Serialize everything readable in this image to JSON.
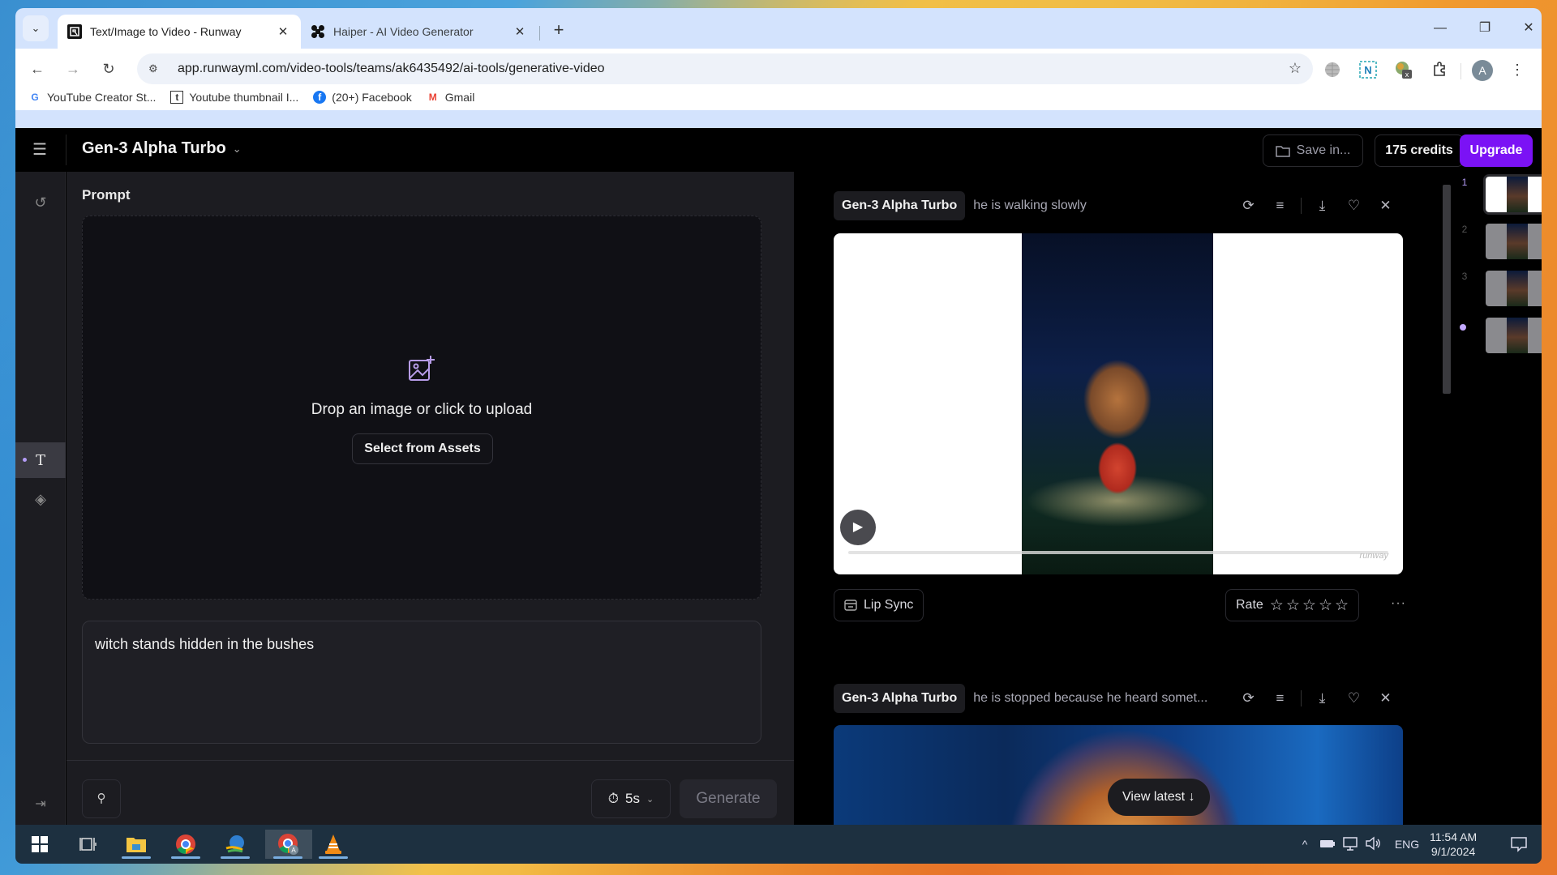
{
  "browser": {
    "tabs": [
      {
        "title": "Text/Image to Video - Runway",
        "favicon": "runway-icon",
        "active": true
      },
      {
        "title": "Haiper - AI Video Generator",
        "favicon": "haiper-icon",
        "active": false
      }
    ],
    "tab_search_icon": "⌄",
    "tab_close_icon": "✕",
    "new_tab_icon": "+",
    "window_controls": {
      "minimize": "—",
      "restore": "❐",
      "close": "✕"
    },
    "nav": {
      "back": "←",
      "forward": "→",
      "reload": "↻"
    },
    "url": "app.runwayml.com/video-tools/teams/ak6435492/ai-tools/generative-video",
    "site_info_icon": "⚙",
    "bookmark_star": "☆",
    "extensions": [
      "globe-icon",
      "n-extension-icon",
      "idm-extension-icon",
      "puzzle-icon"
    ],
    "profile_initial": "A",
    "menu_icon": "⋮",
    "bookmarks": [
      {
        "label": "YouTube Creator St...",
        "icon": "G",
        "color": "#4285f4"
      },
      {
        "label": "Youtube thumbnail I...",
        "icon": "t",
        "color": "#333333"
      },
      {
        "label": "(20+) Facebook",
        "icon": "f",
        "color": "#1877f2"
      },
      {
        "label": "Gmail",
        "icon": "M",
        "color": "#ea4335"
      }
    ]
  },
  "app": {
    "menu_icon": "☰",
    "model_name": "Gen-3 Alpha Turbo",
    "model_chevron": "⌄",
    "save_label": "Save in...",
    "credits_label": "175 credits",
    "upgrade_label": "Upgrade",
    "accent_color": "#7b12f5",
    "rail": {
      "reset_icon": "↺",
      "text_icon": "T",
      "layers_icon": "◈",
      "collapse_icon": "⇥"
    },
    "prompt": {
      "label": "Prompt",
      "dropzone_text": "Drop an image or click to upload",
      "select_assets_label": "Select from Assets",
      "text_value": "witch stands hidden in the bushes",
      "settings_icon": "⚲",
      "duration_icon": "⏱",
      "duration_value": "5s",
      "duration_chevron": "⌄",
      "generate_label": "Generate"
    },
    "feed": {
      "cards": [
        {
          "model": "Gen-3 Alpha Turbo",
          "prompt": "he is walking slowly",
          "play_icon": "▶",
          "watermark": "runway",
          "lip_sync_label": "Lip Sync",
          "rate_label": "Rate",
          "rating": 0,
          "rating_max": 5,
          "more_icon": "···"
        },
        {
          "model": "Gen-3 Alpha Turbo",
          "prompt": "he is stopped because he heard somet..."
        }
      ],
      "action_icons": {
        "reuse": "⟳",
        "details": "≡",
        "download": "⤓",
        "favorite": "♡",
        "close": "✕"
      },
      "view_latest_label": "View latest ↓",
      "thumbnails": [
        {
          "label": "1",
          "selected": true
        },
        {
          "label": "2",
          "selected": false
        },
        {
          "label": "3",
          "selected": false
        },
        {
          "label": "",
          "selected": false,
          "new": true
        }
      ]
    }
  },
  "taskbar": {
    "apps": [
      "windows-start",
      "task-view",
      "file-explorer",
      "chrome-profile-1",
      "internet-download-manager",
      "chrome-profile-a",
      "vlc"
    ],
    "tray": {
      "chevron": "^",
      "language": "ENG"
    },
    "time": "11:54 AM",
    "date": "9/1/2024"
  }
}
